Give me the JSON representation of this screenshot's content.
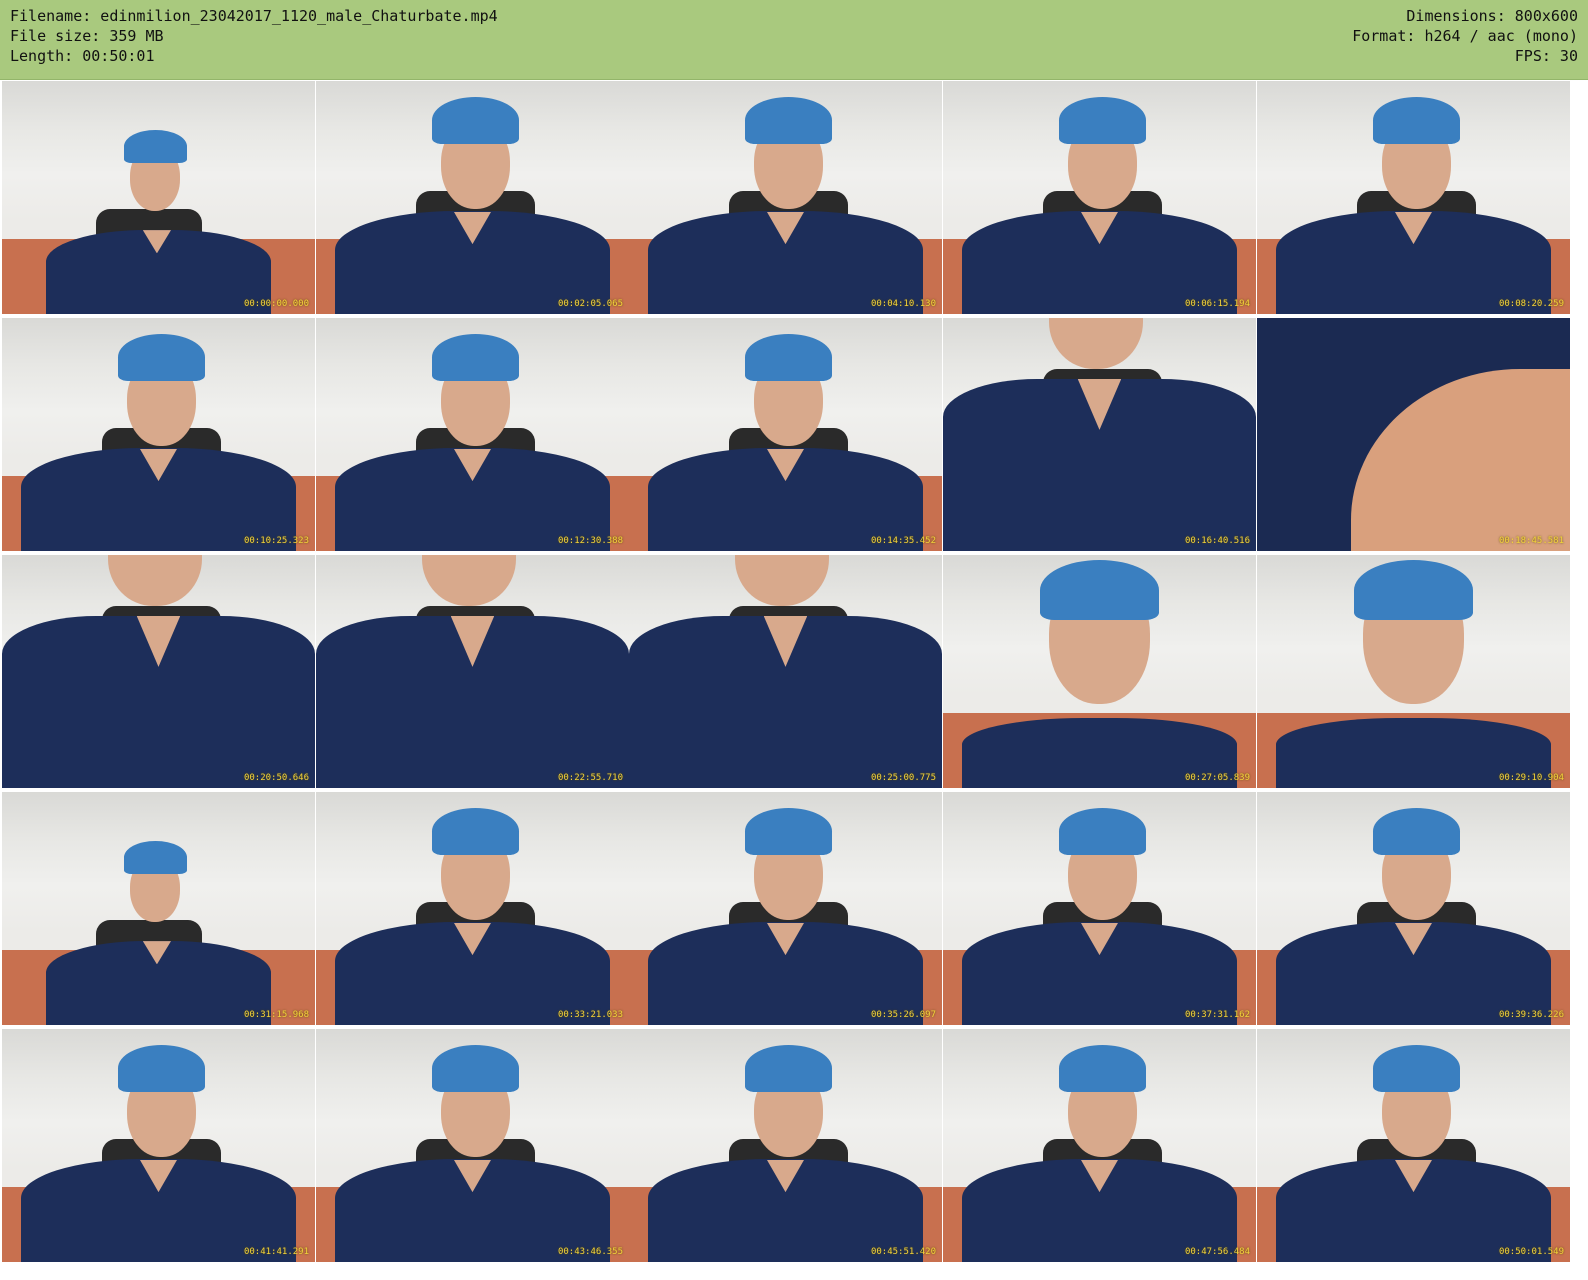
{
  "header": {
    "filename_line": "Filename: edinmilion_23042017_1120_male_Chaturbate.mp4",
    "filesize_line": "File size: 359 MB",
    "length_line": "Length: 00:50:01",
    "dimensions_line": "Dimensions: 800x600",
    "format_line": "Format: h264 / aac (mono)",
    "fps_line": "FPS: 30"
  },
  "colors": {
    "header_bg": "#a9c97e",
    "timestamp": "#f2d23a"
  },
  "thumbnails": [
    {
      "timestamp": "00:00:00.000",
      "variant": "v-far"
    },
    {
      "timestamp": "00:02:05.065",
      "variant": ""
    },
    {
      "timestamp": "00:04:10.130",
      "variant": ""
    },
    {
      "timestamp": "00:06:15.194",
      "variant": ""
    },
    {
      "timestamp": "00:08:20.259",
      "variant": ""
    },
    {
      "timestamp": "00:10:25.323",
      "variant": ""
    },
    {
      "timestamp": "00:12:30.388",
      "variant": ""
    },
    {
      "timestamp": "00:14:35.452",
      "variant": ""
    },
    {
      "timestamp": "00:16:40.516",
      "variant": "v-chest"
    },
    {
      "timestamp": "00:18:45.581",
      "variant": "v-arm"
    },
    {
      "timestamp": "00:20:50.646",
      "variant": "v-chest"
    },
    {
      "timestamp": "00:22:55.710",
      "variant": "v-chest"
    },
    {
      "timestamp": "00:25:00.775",
      "variant": "v-chest"
    },
    {
      "timestamp": "00:27:05.839",
      "variant": "v-close"
    },
    {
      "timestamp": "00:29:10.904",
      "variant": "v-close"
    },
    {
      "timestamp": "00:31:15.968",
      "variant": "v-far"
    },
    {
      "timestamp": "00:33:21.033",
      "variant": ""
    },
    {
      "timestamp": "00:35:26.097",
      "variant": ""
    },
    {
      "timestamp": "00:37:31.162",
      "variant": ""
    },
    {
      "timestamp": "00:39:36.226",
      "variant": ""
    },
    {
      "timestamp": "00:41:41.291",
      "variant": ""
    },
    {
      "timestamp": "00:43:46.355",
      "variant": ""
    },
    {
      "timestamp": "00:45:51.420",
      "variant": ""
    },
    {
      "timestamp": "00:47:56.484",
      "variant": ""
    },
    {
      "timestamp": "00:50:01.549",
      "variant": ""
    }
  ]
}
